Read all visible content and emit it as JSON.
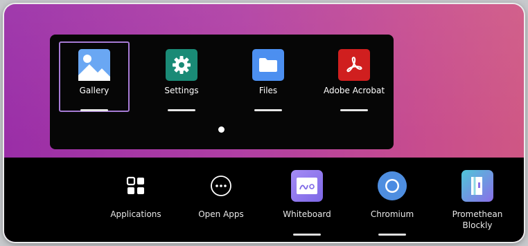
{
  "launcher": {
    "apps": [
      {
        "label": "Gallery",
        "icon": "gallery-icon",
        "selected": true
      },
      {
        "label": "Settings",
        "icon": "gear-icon"
      },
      {
        "label": "Files",
        "icon": "folder-icon"
      },
      {
        "label": "Adobe Acrobat",
        "icon": "acrobat-icon"
      }
    ],
    "page_indicator": {
      "pages": 1,
      "current": 1
    }
  },
  "dock": {
    "items": [
      {
        "label": "Applications",
        "icon": "grid-icon"
      },
      {
        "label": "Open Apps",
        "icon": "ellipsis-circle-icon"
      },
      {
        "label": "Whiteboard",
        "icon": "whiteboard-icon"
      },
      {
        "label": "Chromium",
        "icon": "chromium-icon"
      },
      {
        "label": "Promethean Blockly",
        "icon": "promethean-blockly-icon"
      }
    ]
  },
  "colors": {
    "wallpaper_left": "#9a2ea7",
    "wallpaper_right": "#cf5784",
    "selection_border": "#a77bd6",
    "settings_icon_bg": "#1a8a76",
    "files_icon_bg": "#4c8ff0",
    "acrobat_icon_bg": "#d01f1f"
  }
}
